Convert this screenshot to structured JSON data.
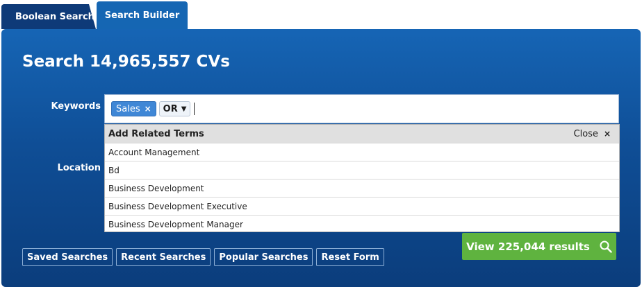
{
  "tabs": [
    {
      "label": "Boolean Search"
    },
    {
      "label": "Search Builder",
      "active": true
    }
  ],
  "header": {
    "title": "Search 14,965,557 CVs"
  },
  "form": {
    "keywords_label": "Keywords",
    "location_label": "Location",
    "keyword_chips": [
      {
        "label": "Sales",
        "remove_glyph": "×"
      }
    ],
    "operator": {
      "value": "OR",
      "caret_glyph": "▼"
    }
  },
  "related_terms": {
    "header_label": "Add Related Terms",
    "close_label": "Close",
    "close_glyph": "×",
    "items": [
      "Account Management",
      "Bd",
      "Business Development",
      "Business Development Executive",
      "Business Development Manager"
    ]
  },
  "actions": {
    "view_results_label": "View 225,044 results",
    "view_results_icon": "search-icon",
    "saved_searches": "Saved Searches",
    "recent_searches": "Recent Searches",
    "popular_searches": "Popular Searches",
    "reset_form": "Reset Form"
  },
  "colors": {
    "panel_blue": "#1566b3",
    "tab_inactive": "#0e3a78",
    "chip_blue": "#3f87d6",
    "view_button_green": "#5fb33f"
  }
}
